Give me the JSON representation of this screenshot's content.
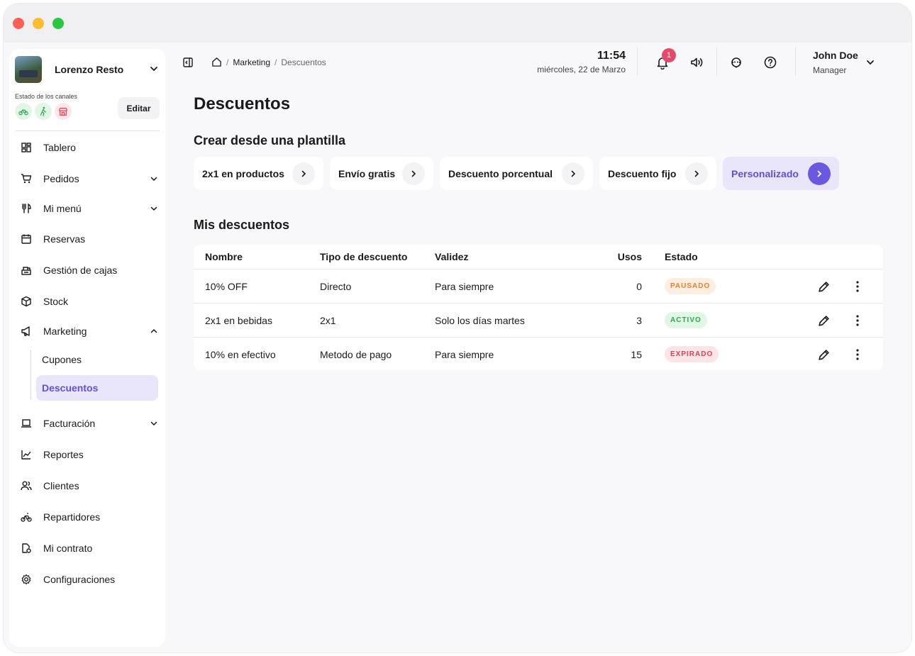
{
  "sidebar": {
    "restaurant_name": "Lorenzo Resto",
    "channels_label": "Estado de los canales",
    "edit_label": "Editar",
    "items": [
      {
        "label": "Tablero",
        "icon": "dashboard-icon"
      },
      {
        "label": "Pedidos",
        "icon": "cart-icon"
      },
      {
        "label": "Mi menú",
        "icon": "cutlery-icon"
      },
      {
        "label": "Reservas",
        "icon": "calendar-icon"
      },
      {
        "label": "Gestión de cajas",
        "icon": "cash-register-icon"
      },
      {
        "label": "Stock",
        "icon": "box-icon"
      },
      {
        "label": "Marketing",
        "icon": "megaphone-icon"
      },
      {
        "label": "Facturación",
        "icon": "laptop-icon"
      },
      {
        "label": "Reportes",
        "icon": "chart-icon"
      },
      {
        "label": "Clientes",
        "icon": "users-icon"
      },
      {
        "label": "Repartidores",
        "icon": "bike-icon"
      },
      {
        "label": "Mi contrato",
        "icon": "contract-icon"
      },
      {
        "label": "Configuraciones",
        "icon": "gear-icon"
      }
    ],
    "marketing_sub": [
      {
        "label": "Cupones"
      },
      {
        "label": "Descuentos"
      }
    ]
  },
  "header": {
    "breadcrumb": [
      "Marketing",
      "Descuentos"
    ],
    "time": "11:54",
    "date": "miércoles, 22 de Marzo",
    "notifications": "1",
    "user_name": "John Doe",
    "user_role": "Manager"
  },
  "main": {
    "title": "Descuentos",
    "templates_title": "Crear desde una plantilla",
    "templates": [
      "2x1 en productos",
      "Envío gratis",
      "Descuento porcentual",
      "Descuento fijo",
      "Personalizado"
    ],
    "list_title": "Mis descuentos",
    "columns": [
      "Nombre",
      "Tipo de descuento",
      "Validez",
      "Usos",
      "Estado"
    ],
    "rows": [
      {
        "name": "10% OFF",
        "type": "Directo",
        "validity": "Para siempre",
        "uses": "0",
        "status": "PAUSADO"
      },
      {
        "name": "2x1 en bebidas",
        "type": "2x1",
        "validity": "Solo los días martes",
        "uses": "3",
        "status": "ACTIVO"
      },
      {
        "name": "10% en efectivo",
        "type": "Metodo de pago",
        "validity": "Para siempre",
        "uses": "15",
        "status": "EXPIRADO"
      }
    ]
  },
  "colors": {
    "accent": "#6a58e0",
    "paused": "#e8822e",
    "active": "#2ea84a",
    "expired": "#e04058"
  }
}
